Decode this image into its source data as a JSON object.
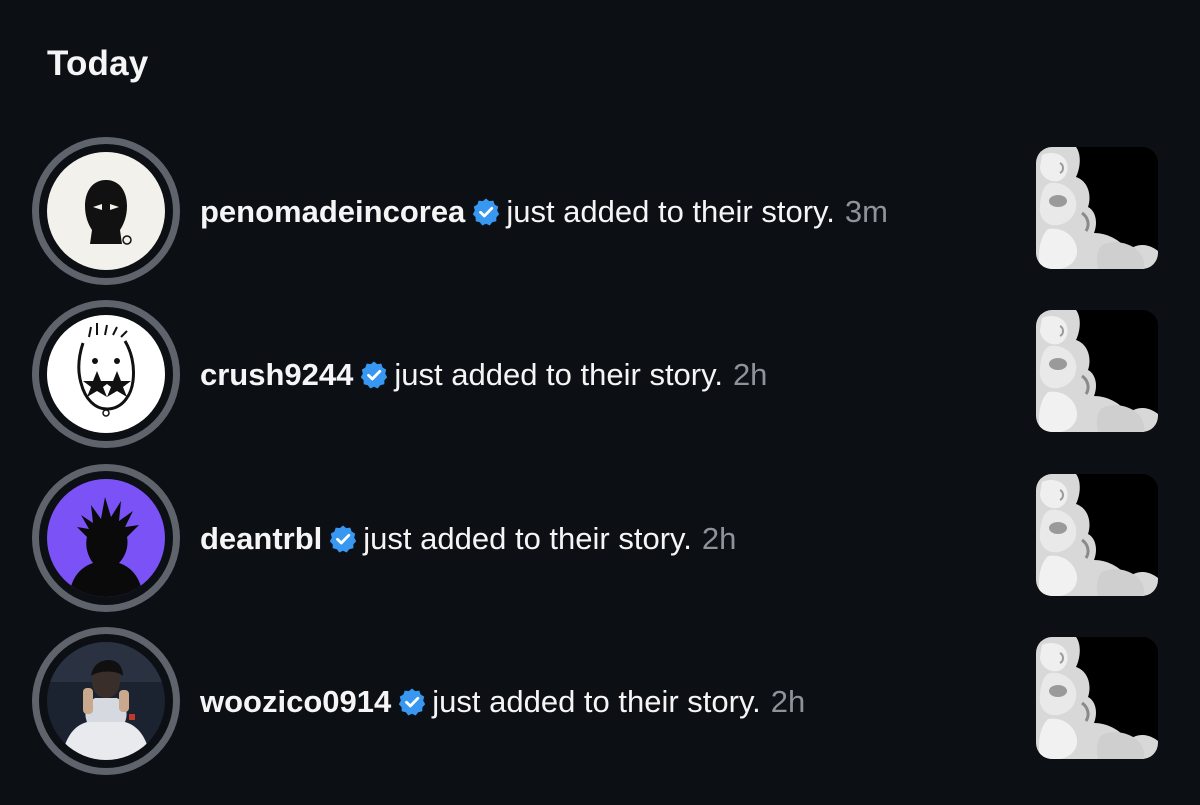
{
  "section": {
    "title": "Today"
  },
  "notifications": [
    {
      "username": "penomadeincorea",
      "action": "just added to their story.",
      "time": "3m",
      "avatar_icon": "balaclava-logo-icon",
      "thumbnail": "monkeys-story-thumbnail"
    },
    {
      "username": "crush9244",
      "action": "just added to their story.",
      "time": "2h",
      "avatar_icon": "star-face-logo-icon",
      "thumbnail": "monkeys-story-thumbnail"
    },
    {
      "username": "deantrbl",
      "action": "just added to their story.",
      "time": "2h",
      "avatar_icon": "spiky-silhouette-icon",
      "thumbnail": "monkeys-story-thumbnail"
    },
    {
      "username": "woozico0914",
      "action": "just added to their story.",
      "time": "2h",
      "avatar_icon": "person-photo-icon",
      "thumbnail": "monkeys-story-thumbnail"
    }
  ],
  "colors": {
    "background": "#0c0f14",
    "text": "#f5f5f5",
    "muted": "#8e939b",
    "verified_badge": "#3897f0",
    "avatar_ring": "#5f636b",
    "purple_avatar": "#7a52f5"
  }
}
